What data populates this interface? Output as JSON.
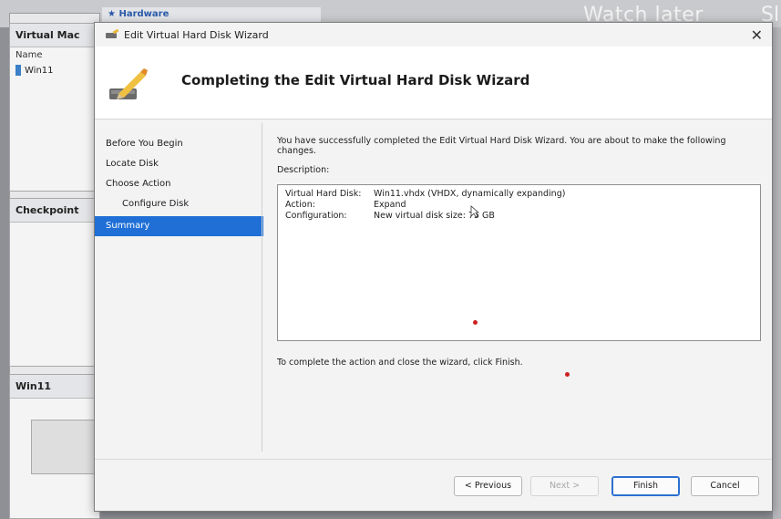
{
  "background": {
    "hardware_label": "Hardware",
    "watch_later": "Watch later",
    "share_partial": "Sl",
    "panes": {
      "virtual_machines": "Virtual Mac",
      "name_column": "Name",
      "vm_name": "Win11",
      "checkpoints": "Checkpoint",
      "selected_vm": "Win11"
    }
  },
  "dialog": {
    "title": "Edit Virtual Hard Disk Wizard",
    "header_title": "Completing the Edit Virtual Hard Disk Wizard",
    "steps": [
      {
        "label": "Before You Begin"
      },
      {
        "label": "Locate Disk"
      },
      {
        "label": "Choose Action"
      },
      {
        "label": "Configure Disk"
      },
      {
        "label": "Summary"
      }
    ],
    "intro_text": "You have successfully completed the Edit Virtual Hard Disk Wizard. You are about to make the following changes.",
    "description_label": "Description:",
    "description": {
      "virtual_hard_disk_key": "Virtual Hard Disk:",
      "virtual_hard_disk_value": "Win11.vhdx (VHDX, dynamically expanding)",
      "action_key": "Action:",
      "action_value": "Expand",
      "configuration_key": "Configuration:",
      "configuration_value": "New virtual disk size: 75 GB"
    },
    "finish_note": "To complete the action and close the wizard, click Finish.",
    "buttons": {
      "previous": "< Previous",
      "next": "Next >",
      "finish": "Finish",
      "cancel": "Cancel"
    }
  }
}
